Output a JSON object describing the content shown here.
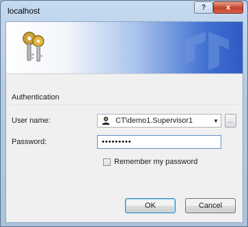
{
  "window": {
    "title": "localhost",
    "help_icon": "?",
    "close_icon": "x"
  },
  "banner": {
    "keys_icon": "keys-icon",
    "logo_icon": "cc-logo-icon"
  },
  "form": {
    "section_label": "Authentication",
    "username_label": "User name:",
    "username_value": "CT\\demo1.Supervisor1",
    "browse_label": "...",
    "password_label": "Password:",
    "password_value": "•••••••••",
    "remember_label": "Remember my password",
    "remember_checked": false
  },
  "buttons": {
    "ok": "OK",
    "cancel": "Cancel"
  },
  "colors": {
    "title_bar": "#b3cbe6",
    "banner_accent": "#3f6fd0",
    "close_button": "#c5402b"
  }
}
